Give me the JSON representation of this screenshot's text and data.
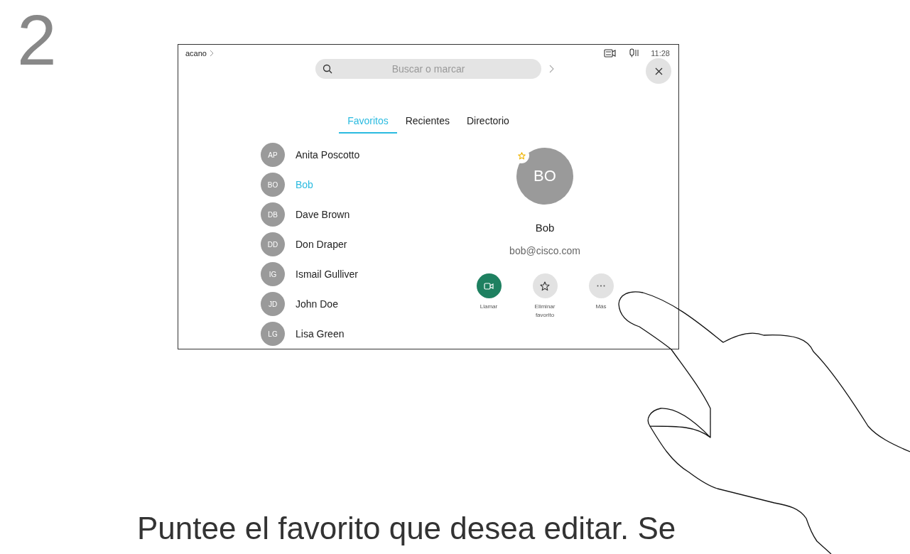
{
  "step_number": "2",
  "status_bar": {
    "brand": "acano",
    "time": "11:28"
  },
  "search": {
    "placeholder": "Buscar o marcar"
  },
  "tabs": [
    {
      "label": "Favoritos",
      "selected": true
    },
    {
      "label": "Recientes",
      "selected": false
    },
    {
      "label": "Directorio",
      "selected": false
    }
  ],
  "contacts": [
    {
      "initials": "AP",
      "name": "Anita Poscotto",
      "selected": false
    },
    {
      "initials": "BO",
      "name": "Bob",
      "selected": true
    },
    {
      "initials": "DB",
      "name": "Dave Brown",
      "selected": false
    },
    {
      "initials": "DD",
      "name": "Don Draper",
      "selected": false
    },
    {
      "initials": "IG",
      "name": "Ismail Gulliver",
      "selected": false
    },
    {
      "initials": "JD",
      "name": "John Doe",
      "selected": false
    },
    {
      "initials": "LG",
      "name": "Lisa Green",
      "selected": false
    }
  ],
  "detail": {
    "initials": "BO",
    "favorite": true,
    "name": "Bob",
    "address": "bob@cisco.com",
    "actions": [
      {
        "kind": "call",
        "label": "Llamar"
      },
      {
        "kind": "unfavorite",
        "label": "Eliminar favorito"
      },
      {
        "kind": "more",
        "label": "Más"
      }
    ]
  },
  "caption": "Puntee el favorito que desea editar. Se"
}
